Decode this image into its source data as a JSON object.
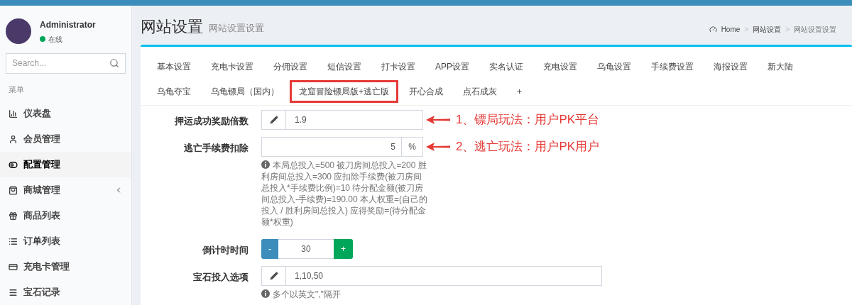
{
  "user": {
    "name": "Administrator",
    "status": "在线",
    "online": true
  },
  "search": {
    "placeholder": "Search..."
  },
  "menu_header": "菜单",
  "menu": [
    {
      "label": "仪表盘",
      "selected": false,
      "submenu": false
    },
    {
      "label": "会员管理",
      "selected": false,
      "submenu": false
    },
    {
      "label": "配置管理",
      "selected": true,
      "submenu": false
    },
    {
      "label": "商城管理",
      "selected": false,
      "submenu": true
    },
    {
      "label": "商品列表",
      "selected": false,
      "submenu": false
    },
    {
      "label": "订单列表",
      "selected": false,
      "submenu": false
    },
    {
      "label": "充电卡管理",
      "selected": false,
      "submenu": false
    },
    {
      "label": "宝石记录",
      "selected": false,
      "submenu": false
    }
  ],
  "page": {
    "title": "网站设置",
    "subtitle": "网站设置设置",
    "breadcrumb": [
      "Home",
      "网站设置",
      "网站设置设置"
    ],
    "breadcrumb_separator": ">"
  },
  "tabs": [
    [
      {
        "label": "基本设置",
        "selected": false
      },
      {
        "label": "充电卡设置",
        "selected": false
      },
      {
        "label": "分佣设置",
        "selected": false
      },
      {
        "label": "短信设置",
        "selected": false
      },
      {
        "label": "打卡设置",
        "selected": false
      },
      {
        "label": "APP设置",
        "selected": false
      },
      {
        "label": "实名认证",
        "selected": false
      },
      {
        "label": "充电设置",
        "selected": false
      },
      {
        "label": "乌龟设置",
        "selected": false
      },
      {
        "label": "手续费设置",
        "selected": false
      },
      {
        "label": "海报设置",
        "selected": false
      },
      {
        "label": "新大陆",
        "selected": false
      }
    ],
    [
      {
        "label": "乌龟夺宝",
        "selected": false
      },
      {
        "label": "乌龟镖局（国内）",
        "selected": false
      },
      {
        "label": "龙窟冒险镖局版+逃亡版",
        "selected": true
      },
      {
        "label": "开心合成",
        "selected": false
      },
      {
        "label": "点石成灰",
        "selected": false
      },
      {
        "label": "+",
        "selected": false
      }
    ]
  ],
  "fields": [
    {
      "kind": "prefix",
      "label": "押运成功奖励倍数",
      "value": "1.9",
      "annotation": "1、镖局玩法：用户PK平台"
    },
    {
      "kind": "suffix",
      "label": "逃亡手续费扣除",
      "value": "5",
      "suffix": "%",
      "annotation": "2、逃亡玩法：用户PK用户",
      "help": "本局总投入=500 被刀房间总投入=200 胜利房间总投入=300 应扣除手续费(被刀房间总投入*手续费比例)=10 待分配金额(被刀房间总投入-手续费)=190.00 本人权重=(自己的投入 / 胜利房间总投入) 应得奖励=(待分配金额*权重)"
    },
    {
      "kind": "stepper",
      "label": "倒计时时间",
      "value": "30",
      "minus": "-",
      "plus": "+"
    },
    {
      "kind": "wide",
      "label": "宝石投入选项",
      "value": "1,10,50",
      "help": "多个以英文\",\"隔开"
    }
  ]
}
